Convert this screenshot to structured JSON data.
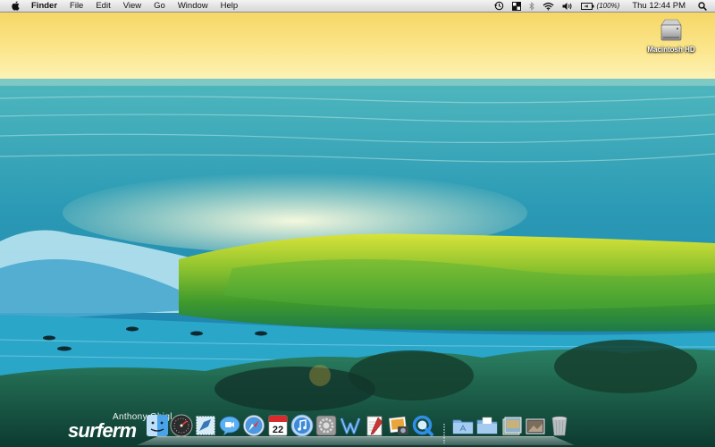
{
  "menubar": {
    "app_name": "Finder",
    "menus": [
      "File",
      "Edit",
      "View",
      "Go",
      "Window",
      "Help"
    ],
    "battery_text": "(100%)",
    "clock": "Thu 12:44 PM"
  },
  "desktop": {
    "icons": [
      {
        "label": "Macintosh HD",
        "icon": "hard-drive-icon"
      }
    ]
  },
  "watermark": {
    "credit": "Anthony Ghigl",
    "brand": "surferm"
  },
  "dock": {
    "items": [
      "finder-icon",
      "dashboard-icon",
      "mail-icon",
      "ichat-icon",
      "safari-icon",
      "ical-icon",
      "itunes-icon",
      "system-preferences-icon",
      "word-icon",
      "textedit-icon",
      "iphoto-icon",
      "quicktime-icon",
      "separator",
      "applications-folder-icon",
      "documents-folder-icon",
      "downloads-stack-icon",
      "pictures-stack-icon",
      "trash-icon"
    ],
    "ical_date": "22"
  },
  "colors": {
    "sky_top": "#f7dc6e",
    "sky_bottom": "#fdf0a8",
    "ocean": "#2fa3b6",
    "wave_green": "#3f9a2c",
    "wave_yellow": "#d9e23a"
  }
}
